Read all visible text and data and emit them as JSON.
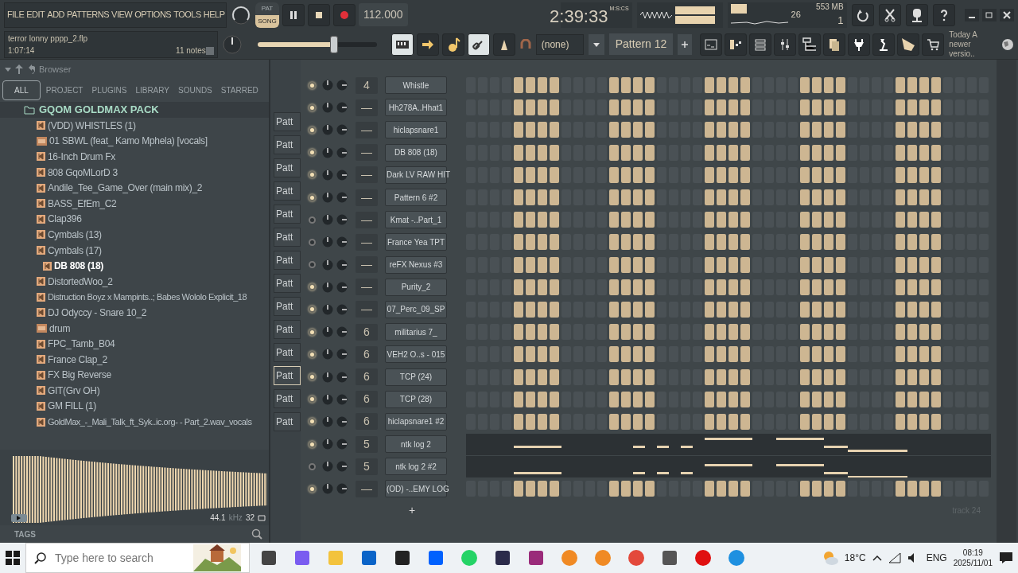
{
  "menu": [
    "FILE",
    "EDIT",
    "ADD",
    "PATTERNS",
    "VIEW",
    "OPTIONS",
    "TOOLS",
    "HELP"
  ],
  "project": {
    "file": "terror lonny pppp_2.flp",
    "time": "1:07:14",
    "notes": "11 notes"
  },
  "transport": {
    "modes": [
      {
        "label": "PAT",
        "selected": false
      },
      {
        "label": "SONG",
        "selected": true
      }
    ],
    "tempo": "112.000",
    "time": "2:39:33",
    "time_unit": "M:S:CS"
  },
  "monitor": {
    "cpu": "26",
    "memory": "553 MB",
    "polyphony": "1"
  },
  "master_volume": {
    "level": 0.64
  },
  "snap": "(none)",
  "pattern": "Pattern 12",
  "news": {
    "line1": "Today  A",
    "line2": "newer versio.."
  },
  "browser": {
    "title": "Browser",
    "tabs": [
      {
        "label": "ALL",
        "selected": true
      },
      {
        "label": "PROJECT",
        "selected": false
      },
      {
        "label": "PLUGINS",
        "selected": false
      },
      {
        "label": "LIBRARY",
        "selected": false
      },
      {
        "label": "SOUNDS",
        "selected": false
      },
      {
        "label": "STARRED",
        "selected": false
      }
    ],
    "folder": "GQOM GOLDMAX PACK",
    "files": [
      {
        "name": "(VDD) WHISTLES (1)",
        "kind": "audio",
        "selected": false
      },
      {
        "name": "01 SBWL (feat_ Kamo Mphela) [vocals]",
        "kind": "mp3",
        "selected": false
      },
      {
        "name": "16-Inch Drum Fx",
        "kind": "audio",
        "selected": false
      },
      {
        "name": "808 GqoMLorD 3",
        "kind": "audio",
        "selected": false
      },
      {
        "name": "Andile_Tee_Game_Over (main mix)_2",
        "kind": "audio",
        "selected": false
      },
      {
        "name": "BASS_EfEm_C2",
        "kind": "audio",
        "selected": false
      },
      {
        "name": "Clap396",
        "kind": "audio",
        "selected": false
      },
      {
        "name": "Cymbals (13)",
        "kind": "audio",
        "selected": false
      },
      {
        "name": "Cymbals (17)",
        "kind": "audio",
        "selected": false
      },
      {
        "name": "DB 808 (18)",
        "kind": "audio",
        "selected": true
      },
      {
        "name": "DistortedWoo_2",
        "kind": "audio",
        "selected": false
      },
      {
        "name": "Distruction Boyz x Mampints..; Babes  Wololo Explicit_18",
        "kind": "audio",
        "selected": false
      },
      {
        "name": "DJ Odyccy - Snare 10_2",
        "kind": "audio",
        "selected": false
      },
      {
        "name": "drum",
        "kind": "mp3",
        "selected": false
      },
      {
        "name": "FPC_Tamb_B04",
        "kind": "audio",
        "selected": false
      },
      {
        "name": "France Clap_2",
        "kind": "audio",
        "selected": false
      },
      {
        "name": "FX Big Reverse",
        "kind": "audio",
        "selected": false
      },
      {
        "name": "GIT(Grv OH)",
        "kind": "audio",
        "selected": false
      },
      {
        "name": "GM FILL (1)",
        "kind": "audio",
        "selected": false
      },
      {
        "name": "GoldMax_-_Mali_Talk_ft_Syk..ic.org- - Part_2.wav_vocals",
        "kind": "audio",
        "selected": false
      }
    ],
    "sample_rate": "44.1",
    "sample_rate_unit": "kHz",
    "bit_depth": "32",
    "tags": "TAGS"
  },
  "playlist_patterns": [
    {
      "label": "Patt",
      "selected": false
    },
    {
      "label": "Patt",
      "selected": false
    },
    {
      "label": "Patt",
      "selected": false
    },
    {
      "label": "Patt",
      "selected": false
    },
    {
      "label": "Patt",
      "selected": false
    },
    {
      "label": "Patt",
      "selected": false
    },
    {
      "label": "Patt",
      "selected": false
    },
    {
      "label": "Patt",
      "selected": false
    },
    {
      "label": "Patt",
      "selected": false
    },
    {
      "label": "Patt",
      "selected": false
    },
    {
      "label": "Patt",
      "selected": false
    },
    {
      "label": "Patt",
      "selected": true
    },
    {
      "label": "Patt",
      "selected": false
    },
    {
      "label": "Patt",
      "selected": false
    }
  ],
  "channels": [
    {
      "name": "Whistle",
      "route": "4",
      "on": true,
      "kind": "steps"
    },
    {
      "name": "Hh278A..Hhat1",
      "route": "—",
      "on": true,
      "kind": "steps"
    },
    {
      "name": "hiclapsnare1",
      "route": "—",
      "on": true,
      "kind": "steps"
    },
    {
      "name": "DB 808 (18)",
      "route": "—",
      "on": true,
      "kind": "steps"
    },
    {
      "name": "Dark LV RAW HIT",
      "route": "—",
      "on": true,
      "kind": "steps"
    },
    {
      "name": "Pattern 6 #2",
      "route": "—",
      "on": true,
      "kind": "steps"
    },
    {
      "name": "Kmat -..Part_1",
      "route": "—",
      "on": false,
      "kind": "steps"
    },
    {
      "name": "France Yea TPT",
      "route": "—",
      "on": false,
      "kind": "steps"
    },
    {
      "name": "reFX Nexus #3",
      "route": "—",
      "on": false,
      "kind": "steps"
    },
    {
      "name": "Purity_2",
      "route": "—",
      "on": true,
      "kind": "steps"
    },
    {
      "name": "07_Perc_09_SP",
      "route": "—",
      "on": true,
      "kind": "steps"
    },
    {
      "name": "militarius 7_",
      "route": "6",
      "on": true,
      "kind": "steps"
    },
    {
      "name": "VEH2 O..s - 015",
      "route": "6",
      "on": true,
      "kind": "steps"
    },
    {
      "name": "TCP (24)",
      "route": "6",
      "on": true,
      "kind": "steps"
    },
    {
      "name": "TCP (28)",
      "route": "6",
      "on": true,
      "kind": "steps"
    },
    {
      "name": "hiclapsnare1 #2",
      "route": "6",
      "on": true,
      "kind": "steps"
    },
    {
      "name": "ntk log 2",
      "route": "5",
      "on": true,
      "kind": "pianoroll"
    },
    {
      "name": "ntk log 2 #2",
      "route": "5",
      "on": false,
      "kind": "pianoroll"
    },
    {
      "name": "(OD) -..EMY LOG",
      "route": "—",
      "on": true,
      "kind": "steps"
    }
  ],
  "add_channel": "+",
  "playlist_track": "track 24",
  "taskbar": {
    "search_placeholder": "Type here to search",
    "weather": "18°C",
    "language": "ENG",
    "time": "08:19",
    "date": "2025/11/01"
  }
}
